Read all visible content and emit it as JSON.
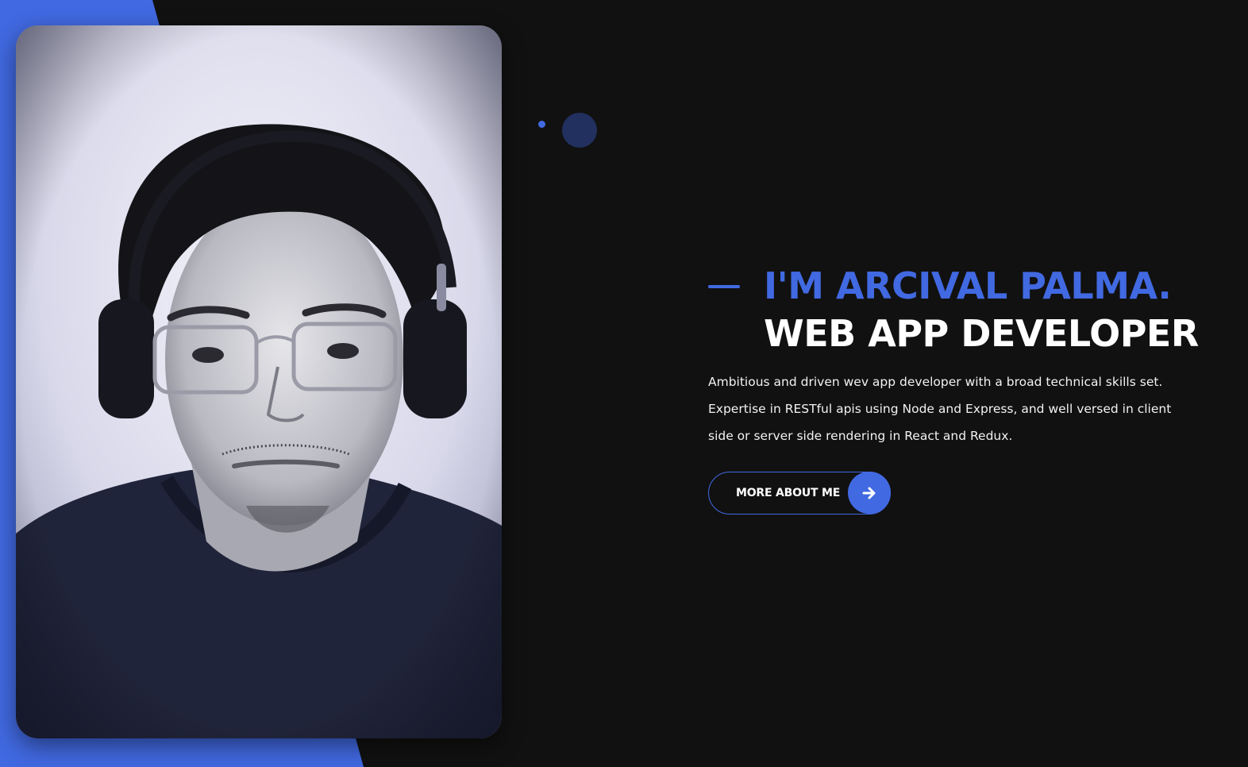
{
  "colors": {
    "background": "#111111",
    "accent": "#4169e1",
    "accent_dark": "#22305f",
    "text": "#ffffff"
  },
  "hero": {
    "photo_alt": "Portrait of Arcival Palma wearing glasses and headphones",
    "title_line_1": "I'M ARCIVAL PALMA.",
    "title_line_2": "WEB APP DEVELOPER",
    "description": "Ambitious and driven wev app developer with a broad technical skills set. Expertise in RESTful apis using Node and Express, and well versed in client side or server side rendering in React and Redux.",
    "cta_label": "MORE ABOUT ME",
    "cta_icon": "arrow-right-icon"
  }
}
